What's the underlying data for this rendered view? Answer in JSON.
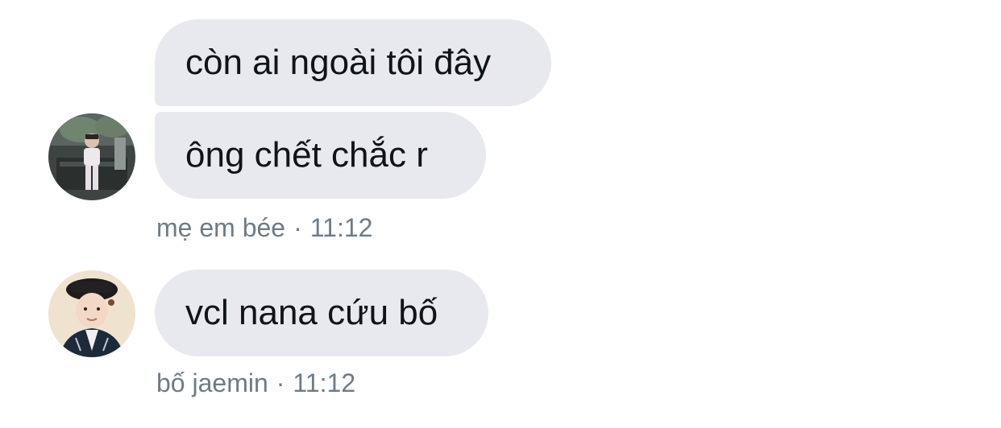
{
  "messages": [
    {
      "text": "còn ai ngoài tôi đây"
    },
    {
      "text": "ông chết chắc r"
    },
    {
      "text": "vcl nana cứu bố"
    }
  ],
  "meta": [
    {
      "sender": "mẹ em bée",
      "separator": "·",
      "time": "11:12"
    },
    {
      "sender": "bố jaemin",
      "separator": "·",
      "time": "11:12"
    }
  ]
}
